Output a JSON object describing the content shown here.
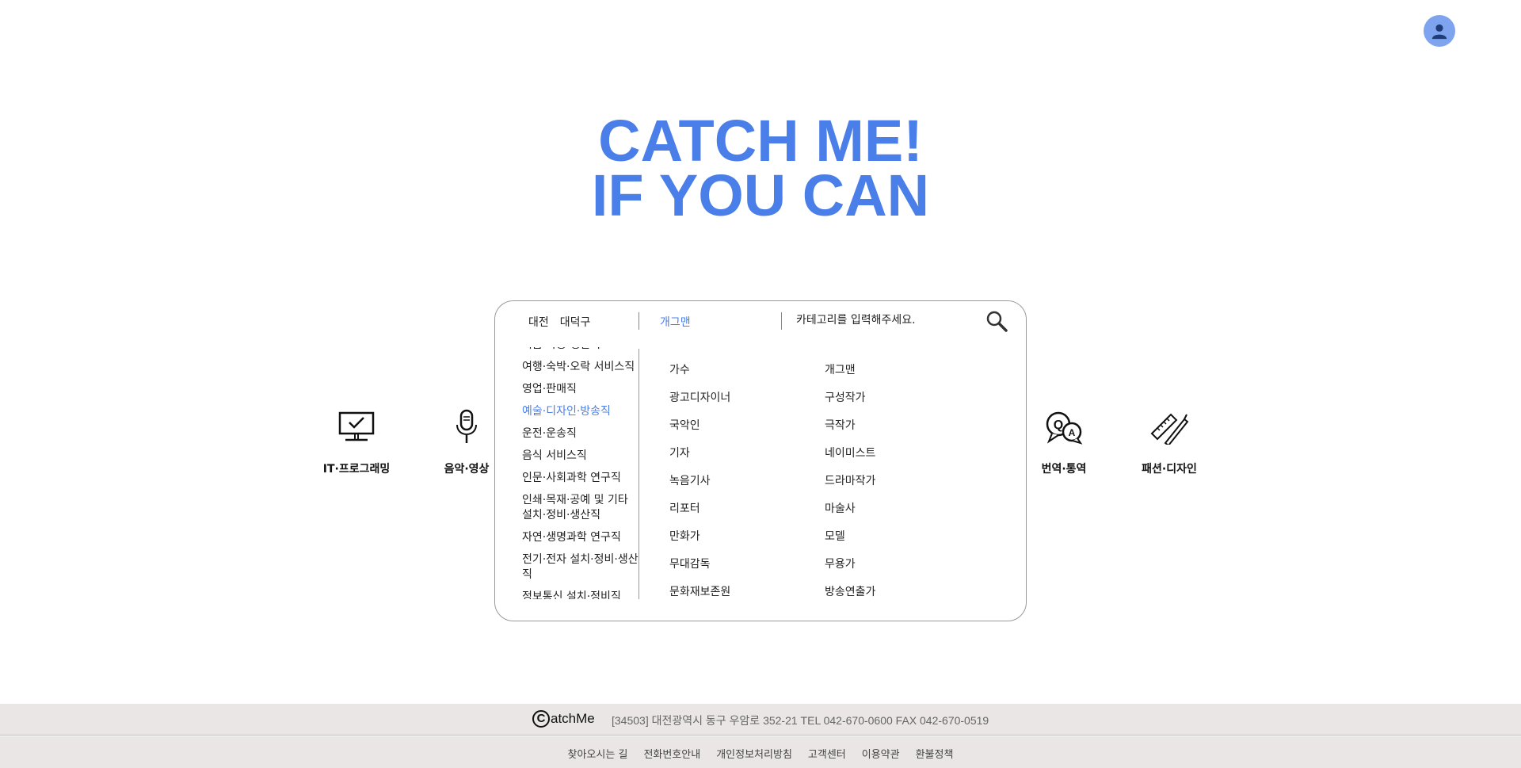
{
  "header": {
    "avatar_icon": "user-icon"
  },
  "hero": {
    "line1": "CATCH ME!",
    "line2": "IF YOU CAN",
    "color": "#4a7ee8"
  },
  "categories": [
    {
      "label": "IT·프로그래밍",
      "icon": "monitor-check-icon"
    },
    {
      "label": "음악·영상",
      "icon": "microphone-icon"
    },
    {
      "label": "번역·통역",
      "icon": "qa-bubble-icon"
    },
    {
      "label": "패션·디자인",
      "icon": "ruler-pencil-icon"
    }
  ],
  "search": {
    "region": {
      "city": "대전",
      "district": "대덕구"
    },
    "selected_job": "개그맨",
    "placeholder": "카테고리를 입력해주세요.",
    "search_icon": "search-icon",
    "job_groups": [
      "식음 가공 생산직",
      "여행·숙박·오락 서비스직",
      "영업·판매직",
      "예술·디자인·방송직",
      "운전·운송직",
      "음식 서비스직",
      "인문·사회과학 연구직",
      "인쇄·목재·공예 및 기타 설치·정비·생산직",
      "자연·생명과학 연구직",
      "전기·전자 설치·정비·생산직",
      "정보통신 설치·정비직"
    ],
    "active_group": "예술·디자인·방송직",
    "jobs": [
      "가수",
      "개그맨",
      "광고디자이너",
      "구성작가",
      "국악인",
      "극작가",
      "기자",
      "네이미스트",
      "녹음기사",
      "드라마작가",
      "리포터",
      "마술사",
      "만화가",
      "모델",
      "무대감독",
      "무용가",
      "문화재보존원",
      "방송연출가"
    ]
  },
  "footer": {
    "logo_text": "atchMe",
    "address": "[34503] 대전광역시 동구 우암로 352-21 TEL 042-670-0600 FAX 042-670-0519",
    "links": [
      "찾아오시는 길",
      "전화번호안내",
      "개인정보처리방침",
      "고객센터",
      "이용약관",
      "환불정책"
    ]
  }
}
